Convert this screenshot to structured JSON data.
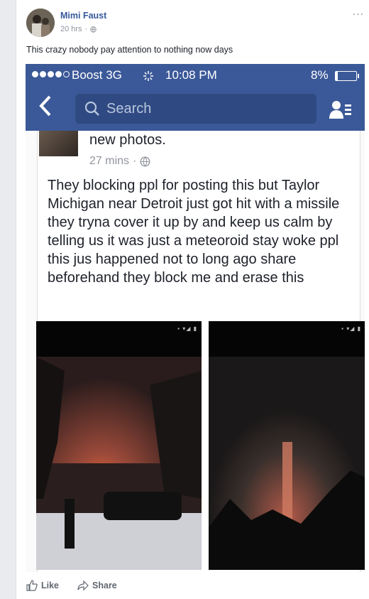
{
  "post": {
    "author": "Mimi Faust",
    "time": "20 hrs",
    "text": "This crazy nobody pay attention to nothing now days",
    "more": "..."
  },
  "screenshot": {
    "status": {
      "carrier": "Boost  3G",
      "time": "10:08 PM",
      "battery": "8%"
    },
    "nav": {
      "search_placeholder": "Search"
    },
    "shared_post": {
      "header_tail": "new photos.",
      "time": "27 mins",
      "body": "They blocking ppl for posting this but Taylor Michigan near Detroit just got hit with a missile they tryna cover it up by and keep us calm by telling us it was just a meteoroid stay woke ppl this jus happened not to long ago share beforehand they block me and erase this"
    }
  },
  "actions": {
    "like": "Like",
    "share": "Share"
  },
  "colors": {
    "fb_blue": "#3b5998",
    "link": "#365899"
  }
}
